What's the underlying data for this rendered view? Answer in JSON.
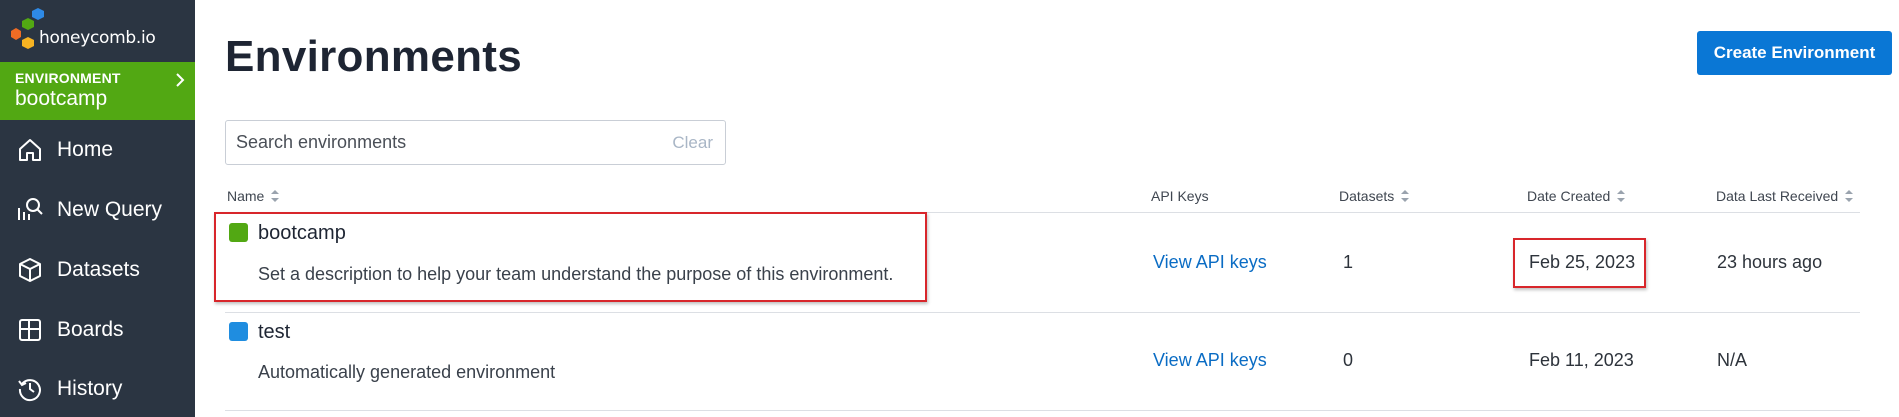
{
  "app": {
    "logo_text": "honeycomb.io",
    "brand_colors": {
      "sidebar": "#2b3542",
      "env_green": "#52a813",
      "primary_blue": "#0a77d5",
      "highlight_red": "#d8262b"
    }
  },
  "sidebar": {
    "environment": {
      "label": "ENVIRONMENT",
      "name": "bootcamp"
    },
    "items": [
      {
        "label": "Home",
        "icon": "home-icon"
      },
      {
        "label": "New Query",
        "icon": "query-icon"
      },
      {
        "label": "Datasets",
        "icon": "cube-icon"
      },
      {
        "label": "Boards",
        "icon": "boards-icon"
      },
      {
        "label": "History",
        "icon": "history-icon"
      }
    ]
  },
  "header": {
    "title": "Environments",
    "create_button": "Create Environment"
  },
  "search": {
    "placeholder": "Search environments",
    "value": "",
    "clear_label": "Clear"
  },
  "table": {
    "columns": [
      {
        "label": "Name",
        "sortable": true
      },
      {
        "label": "API Keys",
        "sortable": false
      },
      {
        "label": "Datasets",
        "sortable": true
      },
      {
        "label": "Date Created",
        "sortable": true
      },
      {
        "label": "Data Last Received",
        "sortable": true
      }
    ],
    "rows": [
      {
        "name": "bootcamp",
        "color": "#52a813",
        "description": "Set a description to help your team understand the purpose of this environment.",
        "api_keys": "View API keys",
        "datasets": "1",
        "date_created": "Feb 25, 2023",
        "last_received": "23 hours ago"
      },
      {
        "name": "test",
        "color": "#1f8de0",
        "description": "Automatically generated environment",
        "api_keys": "View API keys",
        "datasets": "0",
        "date_created": "Feb 11, 2023",
        "last_received": "N/A"
      }
    ]
  }
}
